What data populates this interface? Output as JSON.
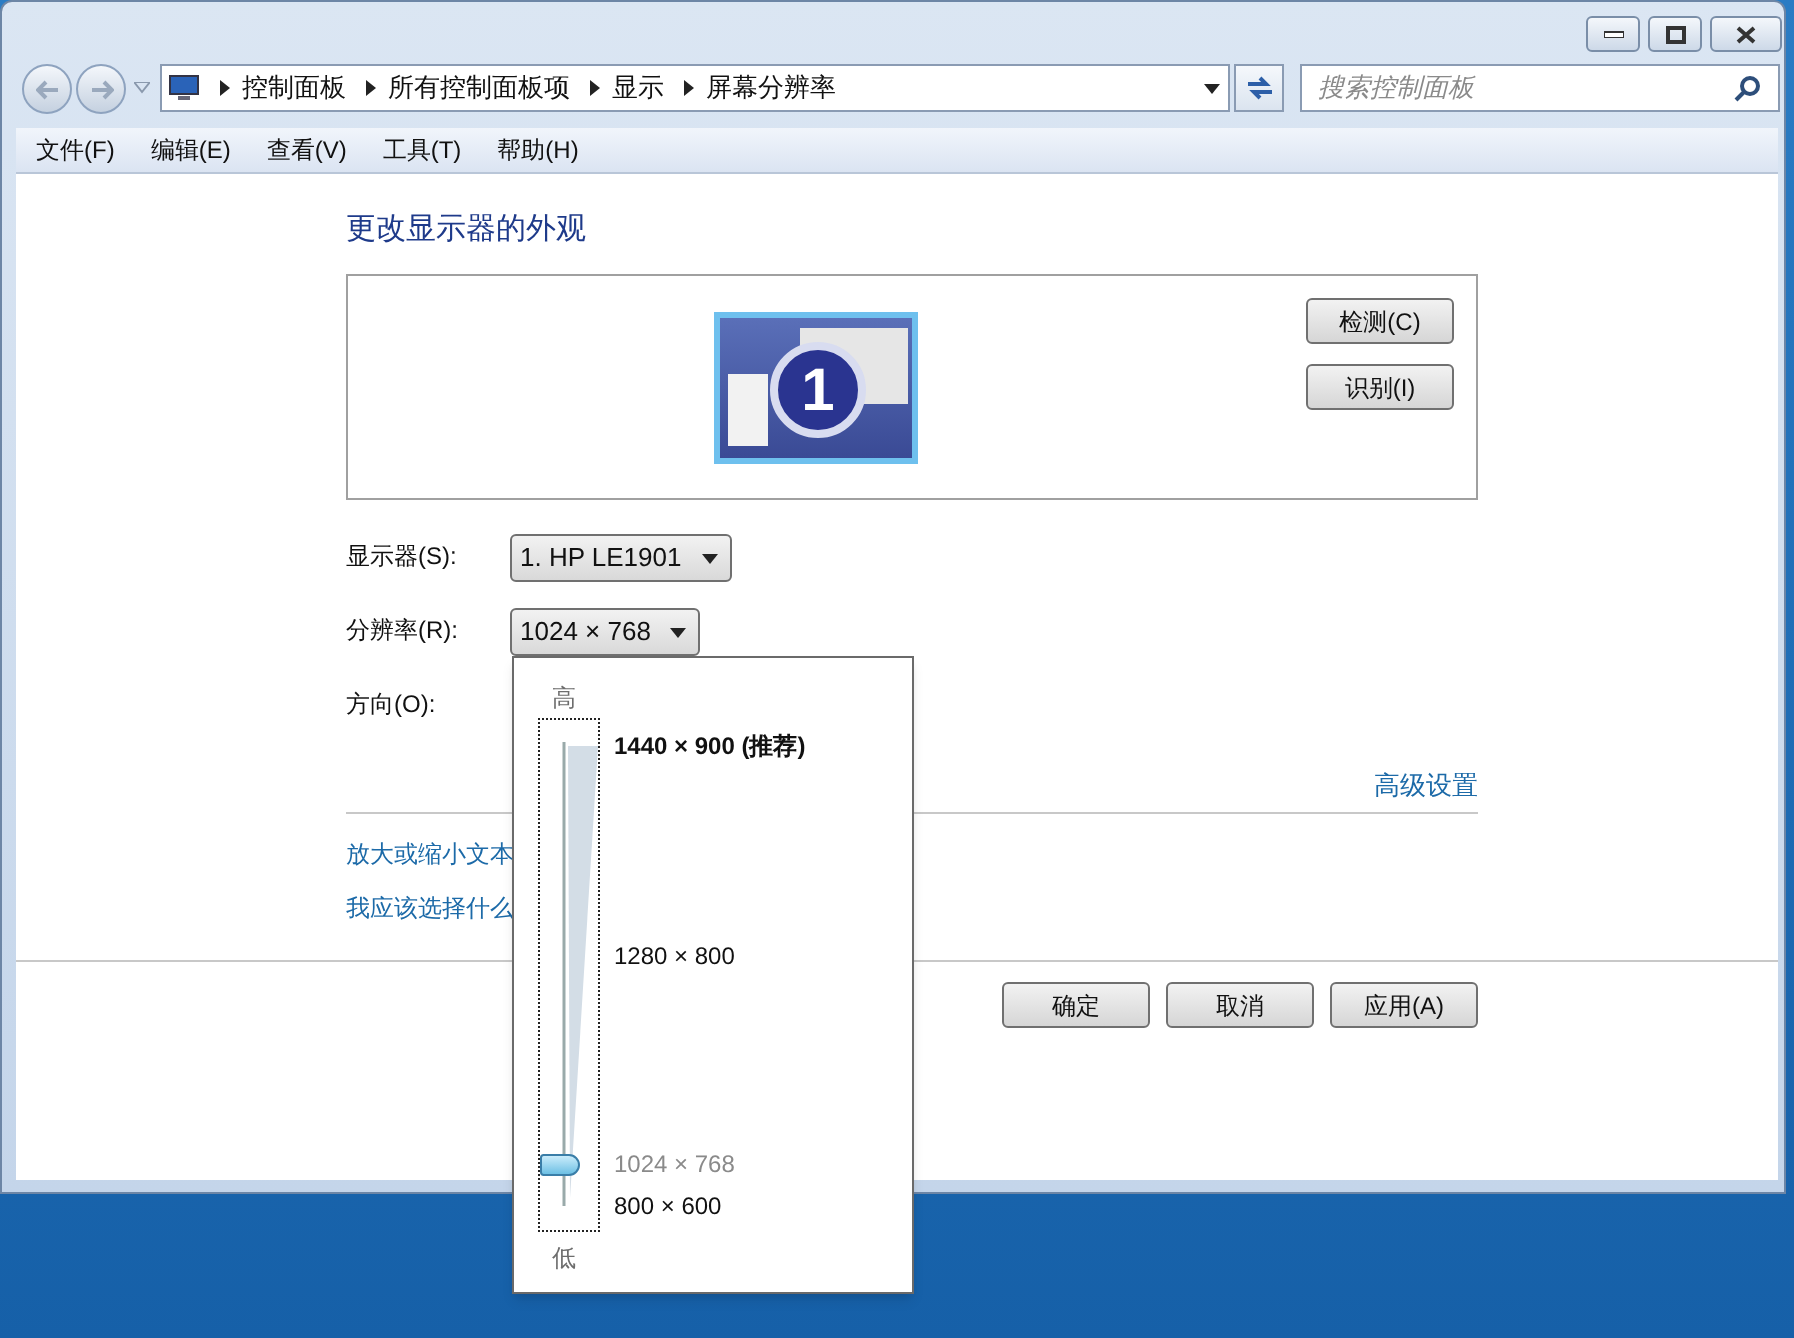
{
  "address_bar": {
    "breadcrumbs": [
      "控制面板",
      "所有控制面板项",
      "显示",
      "屏幕分辨率"
    ]
  },
  "search": {
    "placeholder": "搜索控制面板"
  },
  "menu": [
    "文件(F)",
    "编辑(E)",
    "查看(V)",
    "工具(T)",
    "帮助(H)"
  ],
  "heading": "更改显示器的外观",
  "monitor": {
    "number": "1"
  },
  "side_buttons": [
    "检测(C)",
    "识别(I)"
  ],
  "settings": [
    {
      "label": "显示器(S):",
      "value": "1. HP LE1901",
      "kind": "dropdown"
    },
    {
      "label": "分辨率(R):",
      "value": "1024 × 768",
      "kind": "dropdown"
    },
    {
      "label": "方向(O):",
      "kind": "hidden"
    }
  ],
  "advanced_link": "高级设置",
  "links": [
    "放大或缩小文本",
    "我应该选择什么"
  ],
  "buttons": [
    "确定",
    "取消",
    "应用(A)"
  ],
  "resolution_popup": {
    "high_label": "高",
    "low_label": "低",
    "level": 0.09,
    "options": [
      {
        "label": "1440 × 900 (推荐)",
        "recommended": true,
        "selected": false
      },
      {
        "label": "1280 × 800",
        "recommended": false,
        "selected": false
      },
      {
        "label": "1024 × 768",
        "recommended": false,
        "selected": true
      },
      {
        "label": "800 × 600",
        "recommended": false,
        "selected": false
      }
    ]
  }
}
